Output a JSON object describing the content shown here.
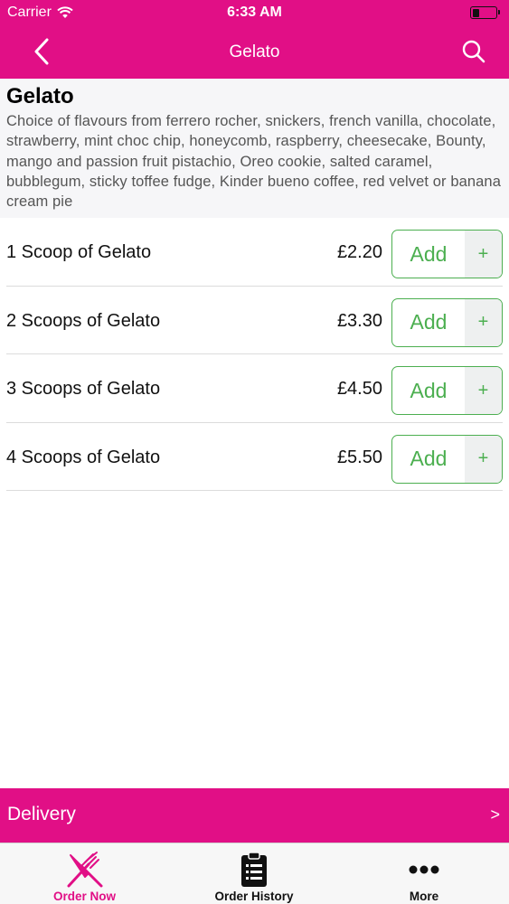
{
  "status_bar": {
    "carrier": "Carrier",
    "time": "6:33 AM",
    "battery_level": 0.3
  },
  "nav_bar": {
    "title": "Gelato",
    "back_icon": "chevron-left-icon",
    "search_icon": "search-icon"
  },
  "header": {
    "title": "Gelato",
    "description": "Choice of flavours from  ferrero rocher, snickers, french vanilla, chocolate, strawberry, mint choc chip, honeycomb, raspberry, cheesecake, Bounty, mango and passion fruit pistachio, Oreo cookie, salted caramel, bubblegum, sticky toffee fudge, Kinder bueno coffee, red velvet or banana cream pie"
  },
  "items": [
    {
      "name": "1 Scoop of Gelato",
      "price": "£2.20",
      "add_label": "Add",
      "plus": "+"
    },
    {
      "name": "2 Scoops of Gelato",
      "price": "£3.30",
      "add_label": "Add",
      "plus": "+"
    },
    {
      "name": "3 Scoops of Gelato",
      "price": "£4.50",
      "add_label": "Add",
      "plus": "+"
    },
    {
      "name": "4 Scoops of Gelato",
      "price": "£5.50",
      "add_label": "Add",
      "plus": "+"
    }
  ],
  "delivery": {
    "label": "Delivery",
    "chevron": ">"
  },
  "tab_bar": {
    "tabs": [
      {
        "label": "Order Now",
        "icon": "fork-knife-icon",
        "active": true
      },
      {
        "label": "Order History",
        "icon": "clipboard-list-icon",
        "active": false
      },
      {
        "label": "More",
        "icon": "more-dots-icon",
        "active": false
      }
    ]
  },
  "colors": {
    "brand": "#e10f86",
    "add_green": "#4caf50",
    "header_bg": "#f6f6f8"
  }
}
